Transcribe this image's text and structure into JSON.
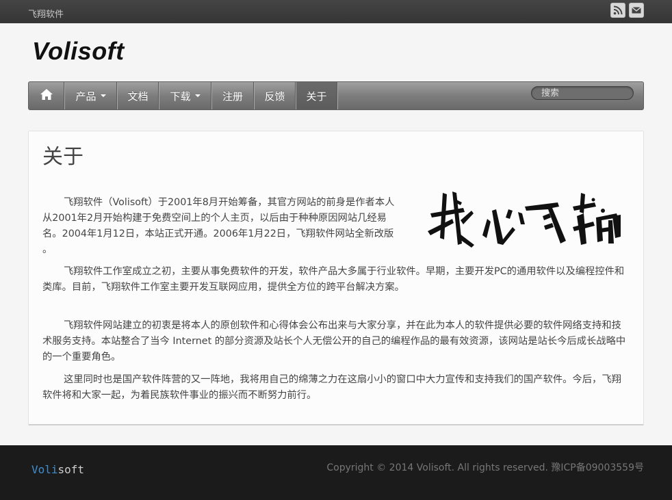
{
  "topbar": {
    "site_name": "飞翔软件",
    "icons": [
      "rss-icon",
      "mail-icon"
    ]
  },
  "brand": {
    "name": "Volisoft"
  },
  "nav": {
    "home_icon": "home-icon",
    "items": [
      {
        "label": "产品",
        "dropdown": true
      },
      {
        "label": "文档",
        "dropdown": false
      },
      {
        "label": "下载",
        "dropdown": true
      },
      {
        "label": "注册",
        "dropdown": false
      },
      {
        "label": "反馈",
        "dropdown": false
      },
      {
        "label": "关于",
        "dropdown": false,
        "active": true
      }
    ],
    "search_placeholder": "搜索"
  },
  "page": {
    "title": "关于",
    "paragraphs": [
      "飞翔软件（Volisoft）于2001年8月开始筹备，其官方网站的前身是作者本人从2001年2月开始构建于免费空间上的个人主页，以后由于种种原因网站几经易名。2004年1月12日，本站正式开通。2006年1月22日，飞翔软件网站全新改版 。",
      "飞翔软件工作室成立之初，主要从事免费软件的开发，软件产品大多属于行业软件。早期，主要开发PC的通用软件以及编程控件和类库。目前，飞翔软件工作室主要开发互联网应用，提供全方位的跨平台解决方案。",
      "飞翔软件网站建立的初衷是将本人的原创软件和心得体会公布出来与大家分享，并在此为本人的软件提供必要的软件网络支持和技术服务支持。本站整合了当今 Internet 的部分资源及站长个人无偿公开的自己的编程作品的最有效资源，该网站是站长今后成长战略中的一个重要角色。",
      "这里同时也是国产软件阵营的又一阵地，我将用自己的绵薄之力在这扇小小的窗口中大力宣传和支持我们的国产软件。今后，飞翔软件将和大家一起，为着民族软件事业的振兴而不断努力前行。"
    ],
    "calligraphy_text": "我心飞翔"
  },
  "footer": {
    "logo_part1": "Voli",
    "logo_part2": "soft",
    "copyright": "Copyright © 2014 Volisoft. All rights reserved. 豫ICP备09003559号"
  },
  "colors": {
    "topbar": "#3d3d3d",
    "footer": "#1b1b1b",
    "logo_accent": "#3f8fd0"
  }
}
